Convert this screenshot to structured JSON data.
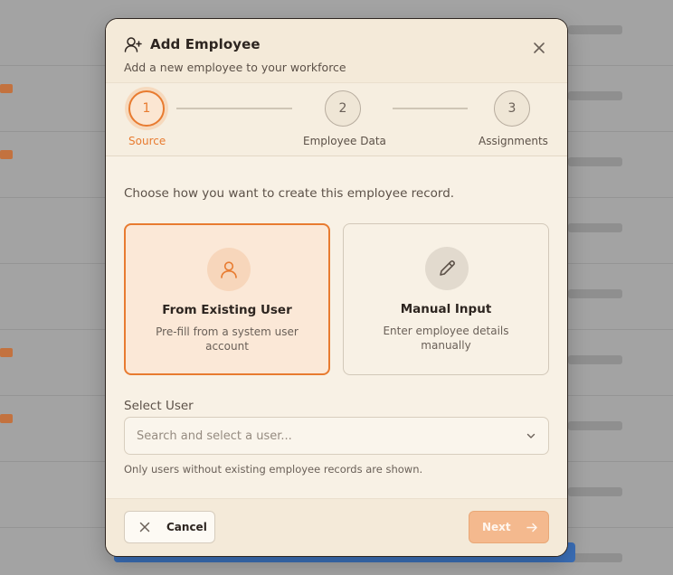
{
  "dialog": {
    "title": "Add Employee",
    "subtitle": "Add a new employee to your workforce"
  },
  "stepper": {
    "steps": [
      {
        "number": "1",
        "label": "Source",
        "active": true
      },
      {
        "number": "2",
        "label": "Employee Data",
        "active": false
      },
      {
        "number": "3",
        "label": "Assignments",
        "active": false
      }
    ]
  },
  "body": {
    "intro": "Choose how you want to create this employee record.",
    "options": [
      {
        "title": "From Existing User",
        "description": "Pre-fill from a system user account",
        "selected": true,
        "icon": "user-icon"
      },
      {
        "title": "Manual Input",
        "description": "Enter employee details manually",
        "selected": false,
        "icon": "pencil-icon"
      }
    ],
    "select_user": {
      "label": "Select User",
      "placeholder": "Search and select a user...",
      "hint": "Only users without existing employee records are shown."
    }
  },
  "footer": {
    "cancel_label": "Cancel",
    "next_label": "Next"
  },
  "colors": {
    "accent": "#e87b30",
    "modal_background": "#f8f1e5",
    "text_primary": "#2d2520"
  }
}
